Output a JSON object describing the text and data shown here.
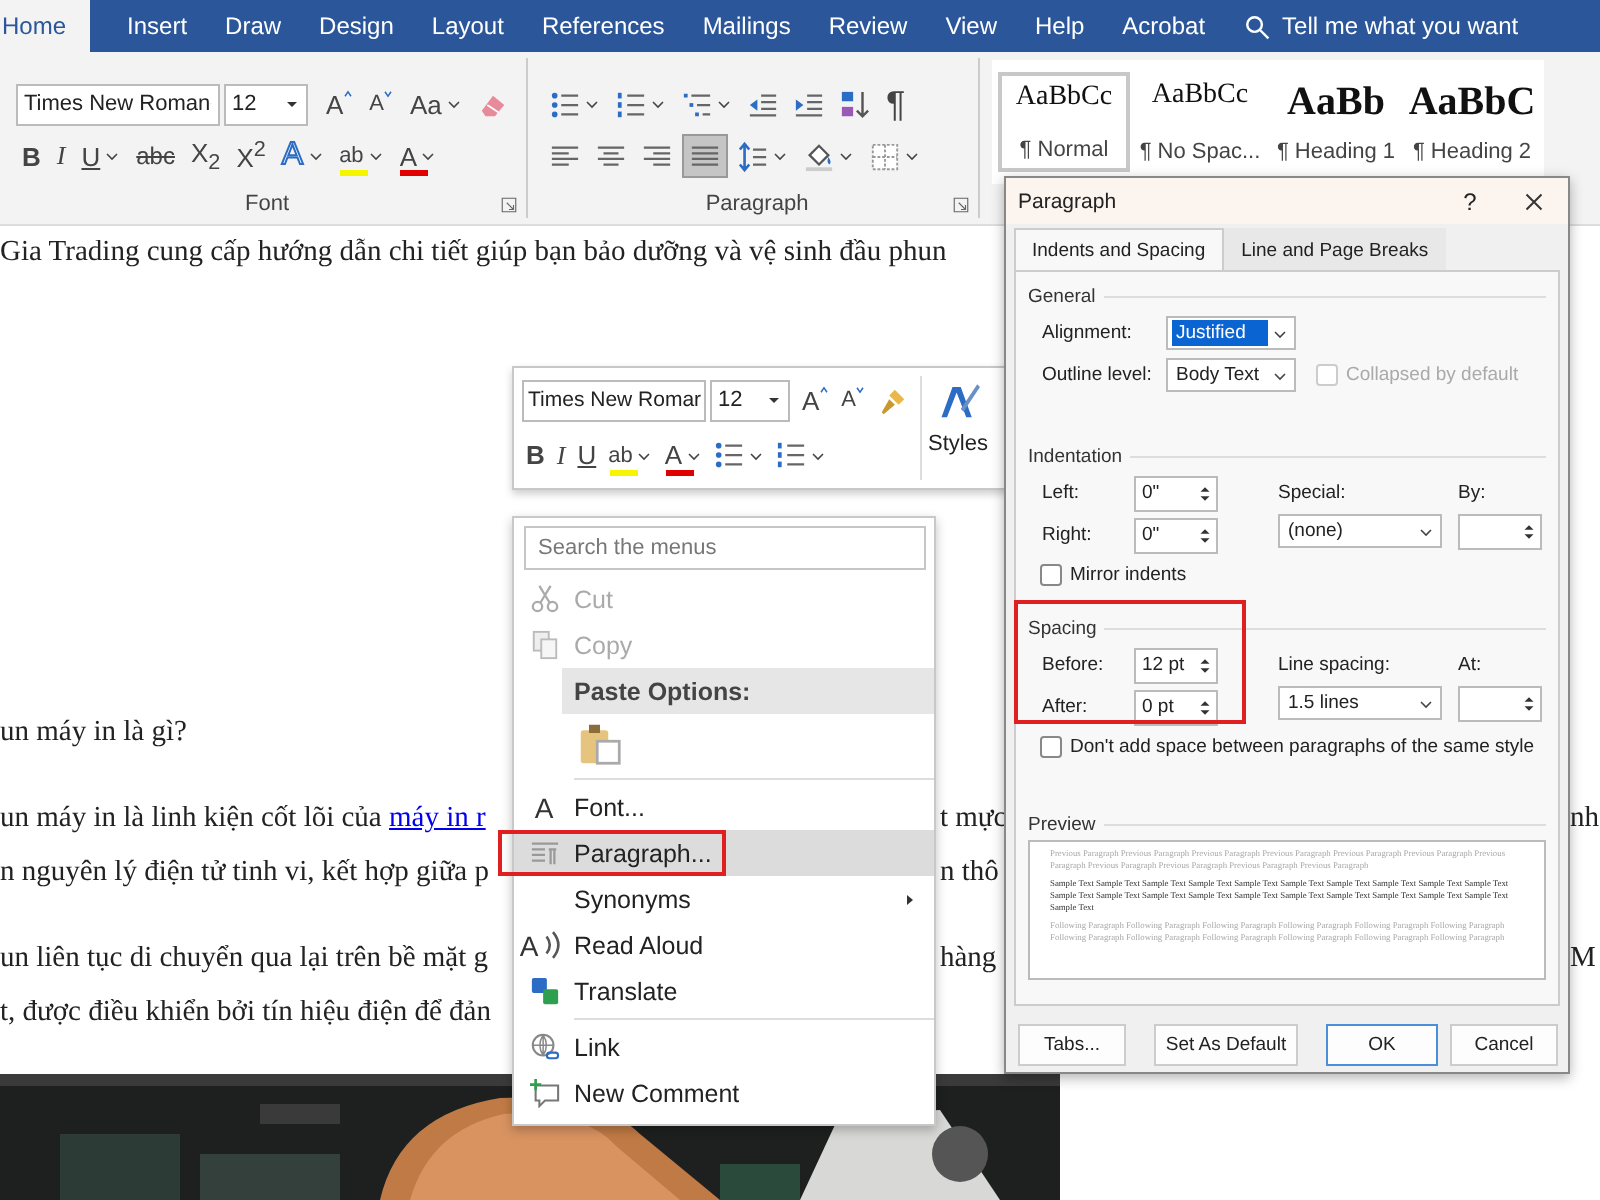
{
  "ribbon_tabs": [
    {
      "label": "Home",
      "selected": true
    },
    {
      "label": "Insert",
      "selected": false
    },
    {
      "label": "Draw",
      "selected": false
    },
    {
      "label": "Design",
      "selected": false
    },
    {
      "label": "Layout",
      "selected": false
    },
    {
      "label": "References",
      "selected": false
    },
    {
      "label": "Mailings",
      "selected": false
    },
    {
      "label": "Review",
      "selected": false
    },
    {
      "label": "View",
      "selected": false
    },
    {
      "label": "Help",
      "selected": false
    },
    {
      "label": "Acrobat",
      "selected": false
    }
  ],
  "tell_me": {
    "placeholder": "Tell me what you want"
  },
  "font_group": {
    "label": "Font",
    "font_name": "Times New Roman",
    "font_size": "12",
    "row_1": [
      {
        "kind": "grow",
        "label": "A"
      },
      {
        "kind": "shrink",
        "label": "A"
      },
      {
        "kind": "case",
        "label": "Aa",
        "dropdown": true
      },
      {
        "kind": "clear"
      }
    ],
    "row_2": [
      {
        "kind": "bold",
        "label": "B"
      },
      {
        "kind": "italic",
        "label": "I"
      },
      {
        "kind": "underline",
        "label": "U",
        "dropdown": true
      },
      {
        "kind": "strike",
        "label": "abc"
      },
      {
        "kind": "sub",
        "label": "X$_{2}$"
      },
      {
        "kind": "sup",
        "label": "X$^{2}$"
      },
      {
        "kind": "effects",
        "label": "A",
        "dropdown": true
      },
      {
        "kind": "highlight",
        "label": "ab",
        "dropdown": true
      },
      {
        "kind": "color",
        "label": "A",
        "dropdown": true
      }
    ]
  },
  "paragraph_group": {
    "label": "Paragraph",
    "row_1": [
      {
        "kind": "bullets",
        "dropdown": true
      },
      {
        "kind": "numbering",
        "dropdown": true
      },
      {
        "kind": "multilevel",
        "dropdown": true
      },
      {
        "kind": "outdent"
      },
      {
        "kind": "indent"
      },
      {
        "kind": "sort"
      },
      {
        "kind": "pilcrow",
        "label": "¶"
      }
    ],
    "alignment": [
      {
        "kind": "left",
        "selected": false
      },
      {
        "kind": "center",
        "selected": false
      },
      {
        "kind": "right",
        "selected": false
      },
      {
        "kind": "justify",
        "selected": true
      }
    ],
    "row_2": [
      {
        "kind": "linespacing",
        "dropdown": true
      },
      {
        "kind": "shading",
        "dropdown": true
      },
      {
        "kind": "borders",
        "dropdown": true
      }
    ]
  },
  "styles": [
    {
      "kind": "body",
      "preview": "AaBbCc",
      "name": "¶ Normal",
      "selected": true
    },
    {
      "kind": "body",
      "preview": "AaBbCc",
      "name": "¶ No Spac...",
      "selected": false
    },
    {
      "kind": "heading",
      "preview": "AaBb",
      "name": "¶ Heading 1",
      "selected": false
    },
    {
      "kind": "heading",
      "preview": "AaBbC",
      "name": "¶ Heading 2",
      "selected": false
    }
  ],
  "document": {
    "paragraphs": [
      {
        "lines": [
          {
            "left": "Gia Trading cung cấp hướng dẫn chi tiết giúp bạn bảo dưỡng và vệ sinh đầu phun"
          }
        ]
      },
      {
        "lines": [
          {
            "left": "un máy in là gì?"
          }
        ]
      },
      {
        "lines": [
          {
            "left": "un máy in là linh kiện cốt lõi của ",
            "link": "máy in r",
            "middle": "t mực",
            "right": "nh"
          },
          {
            "left": "n nguyên lý điện tử tinh vi, kết hợp giữa p",
            "middle": "n thô"
          }
        ]
      },
      {
        "lines": [
          {
            "left": "un liên tục di chuyển qua lại trên bề mặt g",
            "middle": "hàng",
            "right": "M"
          },
          {
            "left": "t, được điều khiển bởi tín hiệu điện để đản"
          }
        ]
      }
    ]
  },
  "mini_toolbar": {
    "font_name": "Times New Romar",
    "font_size": "12",
    "row_1": [
      {
        "kind": "grow",
        "label": "A"
      },
      {
        "kind": "shrink",
        "label": "A"
      },
      {
        "kind": "painter"
      }
    ],
    "row_2": [
      {
        "kind": "bold",
        "label": "B"
      },
      {
        "kind": "italic",
        "label": "I"
      },
      {
        "kind": "underline",
        "label": "U"
      },
      {
        "kind": "highlight",
        "label": "ab",
        "dropdown": true
      },
      {
        "kind": "color",
        "label": "A",
        "dropdown": true
      },
      {
        "kind": "bullets",
        "dropdown": true
      },
      {
        "kind": "numbering",
        "dropdown": true
      }
    ],
    "styles": {
      "label": "Styles"
    }
  },
  "context_menu": {
    "search": {
      "placeholder": "Search the menus"
    },
    "items": [
      {
        "kind": "cut",
        "label": "Cut",
        "disabled": true,
        "selected": false,
        "annotated": false
      },
      {
        "kind": "copy",
        "label": "Copy",
        "disabled": true,
        "selected": false,
        "annotated": false
      },
      {
        "kind": "header",
        "label": "Paste Options:"
      },
      {
        "kind": "paste"
      },
      {
        "kind": "separator"
      },
      {
        "kind": "font",
        "icon_text": "A",
        "label": "Font...",
        "disabled": false,
        "selected": false,
        "annotated": false
      },
      {
        "kind": "paragraph",
        "label": "Paragraph...",
        "disabled": false,
        "selected": true,
        "annotated": true
      },
      {
        "kind": "synonyms",
        "label": "Synonyms",
        "submenu": true,
        "disabled": false,
        "selected": false,
        "annotated": false
      },
      {
        "kind": "readaloud",
        "icon_text": "A",
        "label": "Read Aloud",
        "disabled": false,
        "selected": false,
        "annotated": false
      },
      {
        "kind": "translate",
        "label": "Translate",
        "disabled": false,
        "selected": false,
        "annotated": false
      },
      {
        "kind": "separator"
      },
      {
        "kind": "link",
        "label": "Link",
        "disabled": false,
        "selected": false,
        "annotated": false
      },
      {
        "kind": "comment",
        "label": "New Comment",
        "disabled": false,
        "selected": false,
        "annotated": false
      }
    ]
  },
  "dialog": {
    "title": "Paragraph",
    "help": "?",
    "tabs": [
      {
        "label": "Indents and Spacing",
        "selected": true
      },
      {
        "label": "Line and Page Breaks",
        "selected": false
      }
    ],
    "general": {
      "title": "General",
      "alignment": {
        "label": "Alignment:",
        "value": "Justified",
        "focused": true
      },
      "outline_level": {
        "label": "Outline level:",
        "value": "Body Text"
      },
      "collapsed": {
        "label": "Collapsed by default",
        "checked": false,
        "disabled": true
      }
    },
    "indentation": {
      "title": "Indentation",
      "left": {
        "label": "Left:",
        "value": "0\""
      },
      "right": {
        "label": "Right:",
        "value": "0\""
      },
      "special": {
        "label": "Special:",
        "value": "(none)"
      },
      "by": {
        "label": "By:"
      },
      "mirror": {
        "label": "Mirror indents",
        "checked": false,
        "disabled": false
      }
    },
    "spacing": {
      "title": "Spacing",
      "annotated": true,
      "before": {
        "label": "Before:",
        "value": "12 pt"
      },
      "after": {
        "label": "After:",
        "value": "0 pt"
      },
      "line_spacing": {
        "label": "Line spacing:",
        "value": "1.5 lines"
      },
      "at": {
        "label": "At:"
      },
      "dont_add": {
        "label": "Don't add space between paragraphs of the same style",
        "checked": false,
        "disabled": false
      }
    },
    "preview": {
      "title": "Preview",
      "previous": "Previous Paragraph Previous Paragraph Previous Paragraph Previous Paragraph Previous Paragraph Previous Paragraph Previous Paragraph Previous Paragraph Previous Paragraph Previous Paragraph Previous Paragraph",
      "sample": "Sample Text Sample Text Sample Text Sample Text Sample Text Sample Text Sample Text Sample Text Sample Text Sample Text Sample Text Sample Text Sample Text Sample Text Sample Text Sample Text Sample Text Sample Text Sample Text Sample Text Sample Text",
      "following": "Following Paragraph Following Paragraph Following Paragraph Following Paragraph Following Paragraph Following Paragraph Following Paragraph Following Paragraph Following Paragraph Following Paragraph Following Paragraph Following Paragraph"
    },
    "buttons": [
      {
        "kind": "normal",
        "label": "Tabs..."
      },
      {
        "kind": "normal",
        "label": "Set As Default"
      },
      {
        "kind": "default",
        "label": "OK"
      },
      {
        "kind": "normal",
        "label": "Cancel"
      }
    ]
  }
}
